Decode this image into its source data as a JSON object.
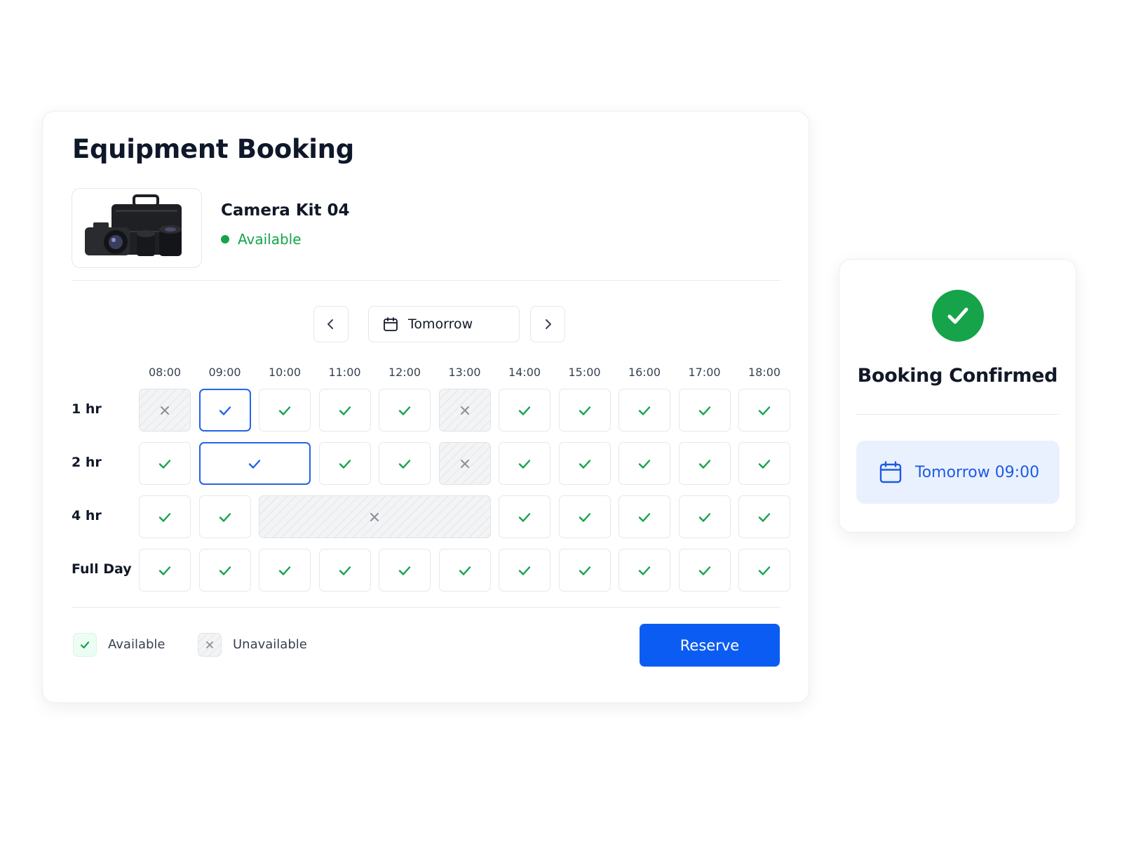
{
  "booking": {
    "title": "Equipment Booking",
    "item": {
      "name": "Camera Kit 04",
      "status": "Available",
      "thumbnail_icon": "camera-kit-image"
    },
    "date": {
      "label": "Tomorrow",
      "icon": "calendar-icon",
      "prev_icon": "chevron-left-icon",
      "next_icon": "chevron-right-icon"
    },
    "times": [
      "08:00",
      "09:00",
      "10:00",
      "11:00",
      "12:00",
      "13:00",
      "14:00",
      "15:00",
      "16:00",
      "17:00",
      "18:00"
    ],
    "rows": [
      {
        "label": "1 hr",
        "slots": [
          {
            "start": "08:00",
            "span": 1,
            "state": "unavailable"
          },
          {
            "start": "09:00",
            "span": 1,
            "state": "selected"
          },
          {
            "start": "10:00",
            "span": 1,
            "state": "available"
          },
          {
            "start": "11:00",
            "span": 1,
            "state": "available"
          },
          {
            "start": "12:00",
            "span": 1,
            "state": "available"
          },
          {
            "start": "13:00",
            "span": 1,
            "state": "unavailable"
          },
          {
            "start": "14:00",
            "span": 1,
            "state": "available"
          },
          {
            "start": "15:00",
            "span": 1,
            "state": "available"
          },
          {
            "start": "16:00",
            "span": 1,
            "state": "available"
          },
          {
            "start": "17:00",
            "span": 1,
            "state": "available"
          },
          {
            "start": "18:00",
            "span": 1,
            "state": "available"
          }
        ]
      },
      {
        "label": "2 hr",
        "slots": [
          {
            "start": "08:00",
            "span": 1,
            "state": "available"
          },
          {
            "start": "09:00",
            "span": 2,
            "state": "selected"
          },
          {
            "start": "11:00",
            "span": 1,
            "state": "available"
          },
          {
            "start": "12:00",
            "span": 1,
            "state": "available"
          },
          {
            "start": "13:00",
            "span": 1,
            "state": "unavailable"
          },
          {
            "start": "14:00",
            "span": 1,
            "state": "available"
          },
          {
            "start": "15:00",
            "span": 1,
            "state": "available"
          },
          {
            "start": "16:00",
            "span": 1,
            "state": "available"
          },
          {
            "start": "17:00",
            "span": 1,
            "state": "available"
          },
          {
            "start": "18:00",
            "span": 1,
            "state": "available"
          }
        ]
      },
      {
        "label": "4 hr",
        "slots": [
          {
            "start": "08:00",
            "span": 1,
            "state": "available"
          },
          {
            "start": "09:00",
            "span": 1,
            "state": "available"
          },
          {
            "start": "10:00",
            "span": 4,
            "state": "unavailable"
          },
          {
            "start": "14:00",
            "span": 1,
            "state": "available"
          },
          {
            "start": "15:00",
            "span": 1,
            "state": "available"
          },
          {
            "start": "16:00",
            "span": 1,
            "state": "available"
          },
          {
            "start": "17:00",
            "span": 1,
            "state": "available"
          },
          {
            "start": "18:00",
            "span": 1,
            "state": "available"
          }
        ]
      },
      {
        "label": "Full Day",
        "slots": [
          {
            "start": "08:00",
            "span": 1,
            "state": "available"
          },
          {
            "start": "09:00",
            "span": 1,
            "state": "available"
          },
          {
            "start": "10:00",
            "span": 1,
            "state": "available"
          },
          {
            "start": "11:00",
            "span": 1,
            "state": "available"
          },
          {
            "start": "12:00",
            "span": 1,
            "state": "available"
          },
          {
            "start": "13:00",
            "span": 1,
            "state": "available"
          },
          {
            "start": "14:00",
            "span": 1,
            "state": "available"
          },
          {
            "start": "15:00",
            "span": 1,
            "state": "available"
          },
          {
            "start": "16:00",
            "span": 1,
            "state": "available"
          },
          {
            "start": "17:00",
            "span": 1,
            "state": "available"
          },
          {
            "start": "18:00",
            "span": 1,
            "state": "available"
          }
        ]
      }
    ],
    "legend": {
      "available": "Available",
      "unavailable": "Unavailable"
    },
    "reserve_label": "Reserve"
  },
  "confirmation": {
    "title": "Booking Confirmed",
    "icon": "check-circle-icon",
    "detail": "Tomorrow 09:00",
    "detail_icon": "calendar-icon"
  },
  "colors": {
    "accent": "#0b5cf2",
    "selected_border": "#2563eb",
    "available": "#16a34a",
    "unavailable": "#9ca3af",
    "confirm_bg": "#eaf1fe",
    "confirm_text": "#1d5ae8"
  }
}
